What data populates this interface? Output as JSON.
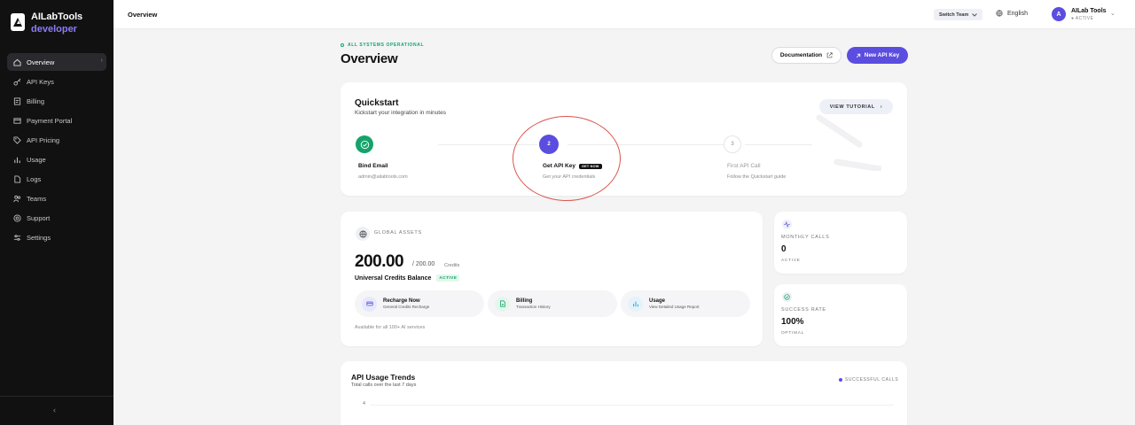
{
  "brand": {
    "name": "AILabTools",
    "subtitle": "developer",
    "accent": "#8b7cf6"
  },
  "sidebar": {
    "items": [
      {
        "label": "Overview",
        "icon": "home-icon",
        "active": true
      },
      {
        "label": "API Keys",
        "icon": "key-icon"
      },
      {
        "label": "Billing",
        "icon": "billing-icon"
      },
      {
        "label": "Payment Portal",
        "icon": "card-icon"
      },
      {
        "label": "API Pricing",
        "icon": "tag-icon"
      },
      {
        "label": "Usage",
        "icon": "bar-chart-icon"
      },
      {
        "label": "Logs",
        "icon": "file-icon"
      },
      {
        "label": "Teams",
        "icon": "users-icon"
      },
      {
        "label": "Support",
        "icon": "lifebuoy-icon"
      },
      {
        "label": "Settings",
        "icon": "sliders-icon"
      }
    ],
    "collapse_glyph": "‹"
  },
  "topbar": {
    "title": "Overview",
    "team_button": "Switch Team",
    "language": "English",
    "user": {
      "initial": "A",
      "name": "AILab Tools",
      "status": "● ACTIVE"
    }
  },
  "header": {
    "system_status": "ALL SYSTEMS OPERATIONAL",
    "title": "Overview",
    "doc_button": "Documentation",
    "new_key_button": "New API Key"
  },
  "quickstart": {
    "title": "Quickstart",
    "subtitle": "Kickstart your integration in minutes",
    "tutorial_button": "VIEW TUTORIAL",
    "steps": [
      {
        "number": "✓",
        "title": "Bind Email",
        "desc": "admin@ailabtools.com",
        "state": "done"
      },
      {
        "number": "2",
        "title": "Get API Key",
        "badge": "GET NOW",
        "desc": "Get your API credentials",
        "state": "current"
      },
      {
        "number": "3",
        "title": "First API Call",
        "desc": "Follow the Quickstart guide",
        "state": "pending"
      }
    ]
  },
  "global_assets": {
    "label": "GLOBAL ASSETS",
    "value": "200.00",
    "total": "/ 200.00",
    "unit": "Credits",
    "balance_label": "Universal Credits Balance",
    "balance_badge": "ACTIVE",
    "actions": [
      {
        "title": "Recharge Now",
        "sub": "General Credits Recharge",
        "icon": "wallet-icon",
        "color": "#e7e8fb"
      },
      {
        "title": "Billing",
        "sub": "Transaction History",
        "icon": "document-icon",
        "color": "#e3f7ed"
      },
      {
        "title": "Usage",
        "sub": "View Detailed Usage Report",
        "icon": "bar-chart-icon",
        "color": "#e4f3fb"
      }
    ],
    "footnote": "Available for all 100+ AI services"
  },
  "stats": [
    {
      "label": "MONTHLY CALLS",
      "value": "0",
      "sub": "ACTIVE",
      "icon": "activity-icon"
    },
    {
      "label": "SUCCESS RATE",
      "value": "100%",
      "sub": "OPTIMAL",
      "icon": "check-circle-icon"
    }
  ],
  "trends": {
    "title": "API Usage Trends",
    "subtitle": "Total calls over the last 7 days",
    "legend": "SUCCESSFUL CALLS",
    "y_tick": "4"
  },
  "colors": {
    "primary": "#5b4de0",
    "success": "#15a36b",
    "annotation": "#d9574f",
    "sidebar_bg": "#111111"
  }
}
